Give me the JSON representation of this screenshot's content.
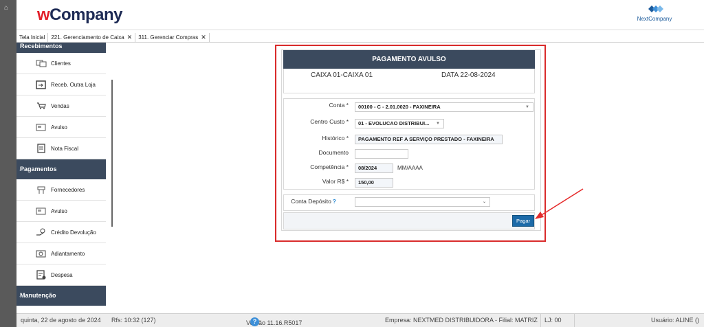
{
  "header": {
    "logo_w": "w",
    "logo_rest": "Company",
    "right_logo": "NextCompany"
  },
  "tabs": [
    {
      "label": "Tela Inicial",
      "closable": false
    },
    {
      "label": "221. Gerenciamento de Caixa",
      "closable": true
    },
    {
      "label": "311. Gerenciar Compras",
      "closable": true
    }
  ],
  "sidebar": {
    "sections": [
      {
        "title": "Recebimentos"
      },
      {
        "title": "Pagamentos"
      },
      {
        "title": "Manutenção"
      }
    ],
    "recebimentos": [
      "Clientes",
      "Receb. Outra Loja",
      "Vendas",
      "Avulso",
      "Nota Fiscal"
    ],
    "pagamentos": [
      "Fornecedores",
      "Avulso",
      "Crédito Devolução",
      "Adiantamento",
      "Despesa"
    ]
  },
  "panel": {
    "title": "PAGAMENTO AVULSO",
    "caixa": "CAIXA  01-CAIXA 01",
    "data": "DATA  22-08-2024"
  },
  "form": {
    "conta_label": "Conta *",
    "conta_value": "00100 - C - 2.01.0020 - FAXINEIRA",
    "centro_label": "Centro Custo *",
    "centro_value": "01 - EVOLUCAO DISTRIBUI...",
    "historico_label": "Histórico *",
    "historico_value": "PAGAMENTO REF A SERVIÇO PRESTADO - FAXINEIRA",
    "documento_label": "Documento",
    "documento_value": "",
    "competencia_label": "Competência *",
    "competencia_value": "08/2024",
    "competencia_hint": "MM/AAAA",
    "valor_label": "Valor R$ *",
    "valor_value": "150,00",
    "deposito_label": "Conta Depósito",
    "deposito_help": "?",
    "deposito_value": "",
    "pagar_label": "Pagar"
  },
  "status": {
    "datetime": "quinta, 22 de agosto de 2024",
    "rfs": "Rfs: 10:32 (127)",
    "versao": "Versão 11.16.R5017",
    "help": "?",
    "empresa": "Empresa: NEXTMED DISTRIBUIDORA - Filial: MATRIZ",
    "lj": "LJ: 00",
    "usuario": "Usuário: ALINE ()"
  },
  "colors": {
    "dark_navy": "#3b4a5e",
    "highlight_red": "#d92b2b",
    "button_blue": "#1c6aa8"
  }
}
